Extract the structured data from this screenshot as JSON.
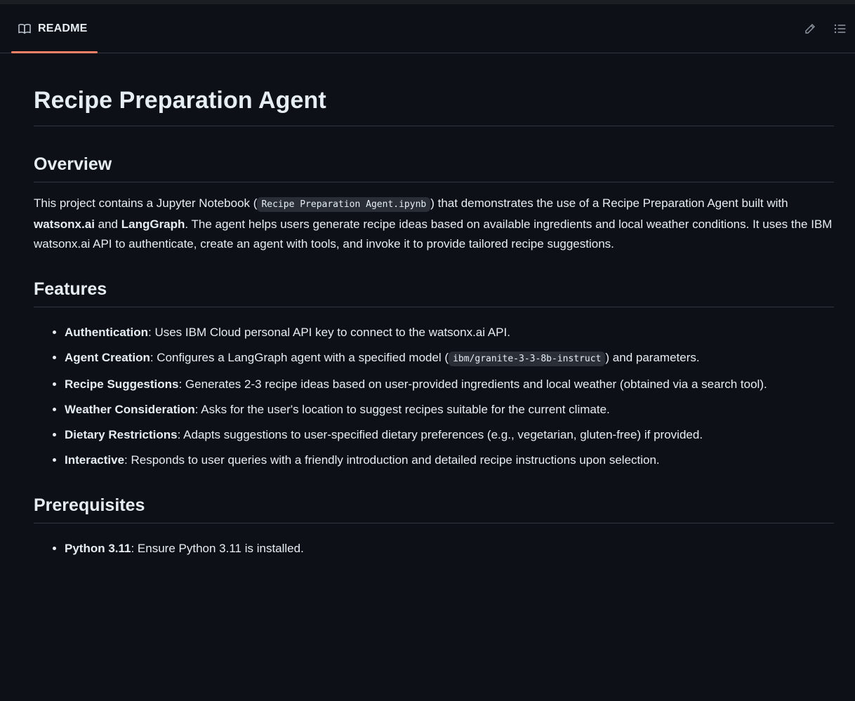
{
  "header": {
    "tab_label": "README",
    "tab_icon": "book-icon",
    "edit_icon": "pencil-icon",
    "outline_icon": "list-icon"
  },
  "doc": {
    "title": "Recipe Preparation Agent",
    "overview": {
      "heading": "Overview",
      "text_1": "This project contains a Jupyter Notebook (",
      "code_1": "Recipe Preparation Agent.ipynb",
      "text_2": ") that demonstrates the use of a Recipe Preparation Agent built with ",
      "bold_1": "watsonx.ai",
      "text_3": " and ",
      "bold_2": "LangGraph",
      "text_4": ". The agent helps users generate recipe ideas based on available ingredients and local weather conditions. It uses the IBM watsonx.ai API to authenticate, create an agent with tools, and invoke it to provide tailored recipe suggestions."
    },
    "features": {
      "heading": "Features",
      "items": [
        {
          "label": "Authentication",
          "text": ": Uses IBM Cloud personal API key to connect to the watsonx.ai API."
        },
        {
          "label": "Agent Creation",
          "text": ": Configures a LangGraph agent with a specified model (",
          "code": "ibm/granite-3-3-8b-instruct",
          "text_after": ") and parameters."
        },
        {
          "label": "Recipe Suggestions",
          "text": ": Generates 2-3 recipe ideas based on user-provided ingredients and local weather (obtained via a search tool)."
        },
        {
          "label": "Weather Consideration",
          "text": ": Asks for the user's location to suggest recipes suitable for the current climate."
        },
        {
          "label": "Dietary Restrictions",
          "text": ": Adapts suggestions to user-specified dietary preferences (e.g., vegetarian, gluten-free) if provided."
        },
        {
          "label": "Interactive",
          "text": ": Responds to user queries with a friendly introduction and detailed recipe instructions upon selection."
        }
      ]
    },
    "prerequisites": {
      "heading": "Prerequisites",
      "items": [
        {
          "label": "Python 3.11",
          "text": ": Ensure Python 3.11 is installed."
        }
      ]
    }
  }
}
